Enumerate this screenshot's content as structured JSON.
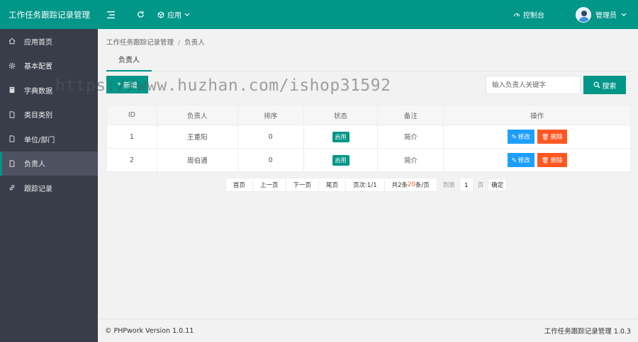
{
  "header": {
    "app_title": "工作任务跟踪记录管理",
    "app_menu_label": "应用",
    "console_label": "控制台",
    "user_name": "管理员"
  },
  "sidebar": {
    "items": [
      {
        "label": "应用首页",
        "icon": "home-icon"
      },
      {
        "label": "基本配置",
        "icon": "gear-icon"
      },
      {
        "label": "字典数据",
        "icon": "book-icon"
      },
      {
        "label": "类目类别",
        "icon": "file-icon"
      },
      {
        "label": "单位/部门",
        "icon": "file-icon"
      },
      {
        "label": "负责人",
        "icon": "file-icon",
        "active": true
      },
      {
        "label": "跟踪记录",
        "icon": "link-icon"
      }
    ]
  },
  "breadcrumb": {
    "root": "工作任务跟踪记录管理",
    "separator": "/",
    "current": "负责人"
  },
  "tab": {
    "label": "负责人"
  },
  "toolbar": {
    "add_label": "新增",
    "search_placeholder": "输入负责人关键字",
    "search_label": "搜索"
  },
  "table": {
    "headers": [
      "ID",
      "负责人",
      "排序",
      "状态",
      "备注",
      "操作"
    ],
    "rows": [
      {
        "id": "1",
        "name": "王重阳",
        "sort": "0",
        "status": "启用",
        "remark": "简介"
      },
      {
        "id": "2",
        "name": "周伯通",
        "sort": "0",
        "status": "启用",
        "remark": "简介"
      }
    ],
    "edit_label": "修改",
    "delete_label": "删除"
  },
  "pager": {
    "first": "首页",
    "prev": "上一页",
    "next": "下一页",
    "last": "尾页",
    "page_info": "页次:1/1",
    "total_prefix": "共2条",
    "per_page_num": "20",
    "per_page_suffix": "条/页",
    "jump_label": "到第",
    "jump_value": "1",
    "page_unit": "页",
    "confirm": "确定"
  },
  "footer": {
    "left": "© PHPwork Version 1.0.11",
    "right": "工作任务跟踪记录管理 1.0.3"
  },
  "watermark": "https://www.huzhan.com/ishop31592",
  "colors": {
    "primary": "#009688",
    "sidebar": "#393d49",
    "edit": "#1e9fff",
    "delete": "#ff5722"
  }
}
